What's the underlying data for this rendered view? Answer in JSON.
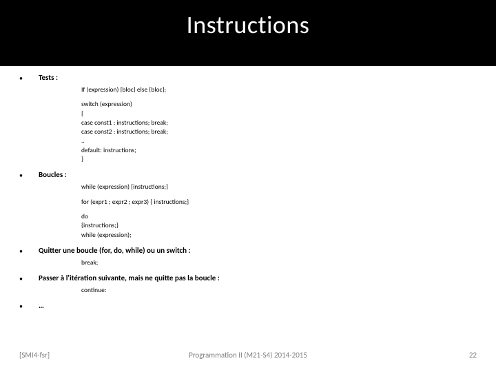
{
  "title": "Instructions",
  "sections": {
    "tests": {
      "label": "Tests :",
      "code1": "If (expression) {bloc} else {bloc};",
      "code2_l1": "switch (expression)",
      "code2_l2": "{",
      "code2_l3": "case const1 : instructions; break;",
      "code2_l4": "case const2 : instructions; break;",
      "code2_l5": "..",
      "code2_l6": "default: instructions;",
      "code2_l7": "}"
    },
    "boucles": {
      "label": "Boucles :",
      "code1": "while (expression) {instructions;}",
      "code2": "for (expr1 ; expr2 ; expr3) { instructions;}",
      "code3_l1": "do",
      "code3_l2": "{instructions;}",
      "code3_l3": "while (expression);"
    },
    "quitter": {
      "label": "Quitter une boucle (for, do, while) ou un switch :",
      "code1": "break;"
    },
    "passer": {
      "label": "Passer à l'itération suivante, mais ne quitte pas la boucle :",
      "code1": "continue:"
    },
    "more": {
      "label": "…"
    }
  },
  "footer": {
    "left": "[SMI4-fsr]",
    "center": "Programmation II (M21-S4) 2014-2015",
    "right": "22"
  }
}
